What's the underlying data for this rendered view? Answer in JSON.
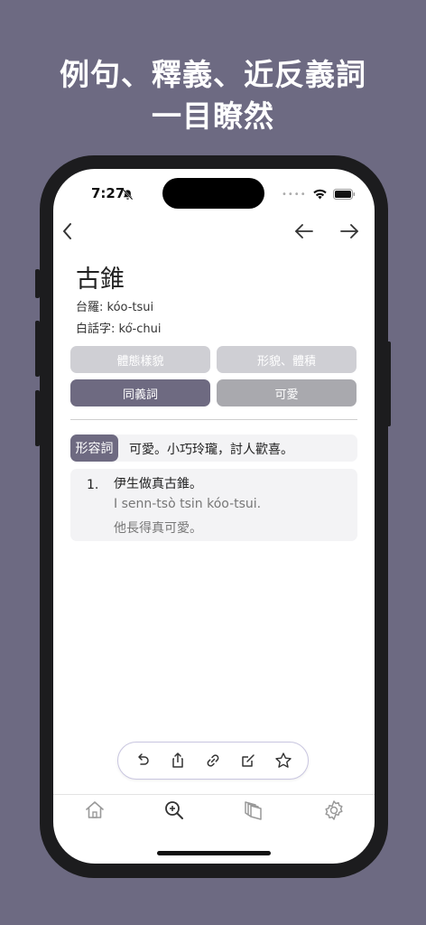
{
  "promo": {
    "line1": "例句、釋義、近反義詞",
    "line2": "一目瞭然"
  },
  "status_bar": {
    "time": "7:27",
    "icons": [
      "bell-slash-icon",
      "signal-dots-icon",
      "wifi-icon",
      "battery-icon"
    ]
  },
  "nav": {
    "icons": [
      "chevron-left-icon",
      "arrow-left-icon",
      "arrow-right-icon"
    ]
  },
  "entry": {
    "title": "古錐",
    "tailo": "台羅: kóo-tsui",
    "poj": "白話字: kó͘-chui"
  },
  "categories": [
    "體態樣貌",
    "形貌、體積",
    "同義詞",
    "可愛"
  ],
  "definition": {
    "pos": "形容詞",
    "text": "可愛。小巧玲瓏，討人歡喜。"
  },
  "example": {
    "number": "1.",
    "hanji": "伊生做真古錐。",
    "romanization": "I senn-tsò tsin kóo-tsui.",
    "translation": "他長得真可愛。"
  },
  "action_bar": {
    "icons": [
      "undo-icon",
      "share-icon",
      "link-icon",
      "edit-icon",
      "star-icon"
    ]
  },
  "tab_bar": {
    "icons": [
      "home-icon",
      "search-zoom-icon",
      "cards-icon",
      "settings-icon"
    ]
  },
  "colors": {
    "background": "#6d6a82",
    "accent": "#6e6a81",
    "chip_light": "#cfcfd4",
    "chip_mid": "#a9a9ae"
  }
}
